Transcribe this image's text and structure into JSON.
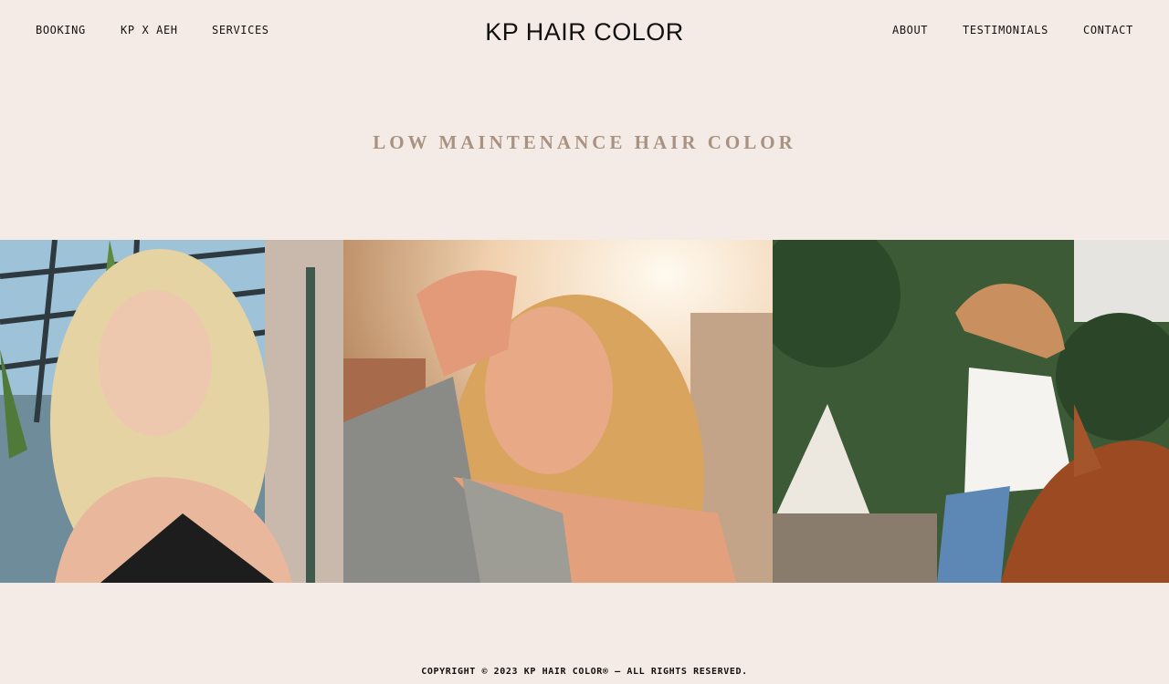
{
  "header": {
    "logo": "KP HAIR COLOR",
    "nav_left": [
      "BOOKING",
      "KP X AEH",
      "SERVICES"
    ],
    "nav_right": [
      "ABOUT",
      "TESTIMONIALS",
      "CONTACT"
    ]
  },
  "main": {
    "title": "LOW MAINTENANCE HAIR COLOR"
  },
  "footer": {
    "copyright": "COPYRIGHT © 2023 KP HAIR COLOR® — ALL RIGHTS RESERVED."
  },
  "colors": {
    "background": "#f5ebe6",
    "title": "#a89382",
    "text": "#111111"
  }
}
